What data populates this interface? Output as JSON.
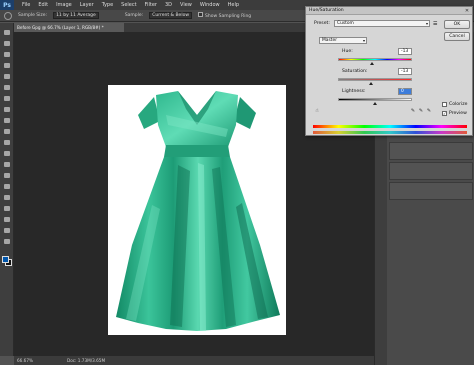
{
  "app": {
    "logo": "Ps"
  },
  "menu": [
    "File",
    "Edit",
    "Image",
    "Layer",
    "Type",
    "Select",
    "Filter",
    "3D",
    "View",
    "Window",
    "Help"
  ],
  "options": {
    "sample_size_label": "Sample Size:",
    "sample_size_value": "11 by 11 Average",
    "sample_label": "Sample:",
    "sample_value": "Current & Below",
    "show_ring_label": "Show Sampling Ring"
  },
  "document": {
    "tab_title": "Before Gpg @ 66.7% (Layer 1, RGB/8#) *"
  },
  "status": {
    "zoom": "66.67%",
    "doc_info": "Doc: 1.73M/3.65M"
  },
  "dialog": {
    "title": "Hue/Saturation",
    "preset_label": "Preset:",
    "preset_value": "Custom",
    "channel_value": "Master",
    "hue_label": "Hue:",
    "hue_value": "-13",
    "saturation_label": "Saturation:",
    "saturation_value": "-13",
    "lightness_label": "Lightness:",
    "lightness_value": "0",
    "ok_label": "OK",
    "cancel_label": "Cancel",
    "colorize_label": "Colorize",
    "preview_label": "Preview",
    "hue_level": 0.46,
    "saturation_level": 0.44,
    "lightness_level": 0.5,
    "preview_checked": true,
    "colorize_checked": false
  },
  "colors": {
    "dress_main": "#2db38a",
    "dress_shadow": "#157a5c",
    "dress_highlight": "#6fe0bd",
    "fg_color": "#0055aa",
    "bg_color": "#111111"
  },
  "icons": {
    "tools": [
      "move-tool-icon",
      "marquee-tool-icon",
      "lasso-tool-icon",
      "quick-select-tool-icon",
      "crop-tool-icon",
      "eyedropper-tool-icon",
      "healing-tool-icon",
      "brush-tool-icon",
      "clone-stamp-tool-icon",
      "history-brush-tool-icon",
      "eraser-tool-icon",
      "gradient-tool-icon",
      "blur-tool-icon",
      "dodge-tool-icon",
      "pen-tool-icon",
      "type-tool-icon",
      "path-select-tool-icon",
      "shape-tool-icon",
      "hand-tool-icon",
      "zoom-tool-icon"
    ]
  }
}
